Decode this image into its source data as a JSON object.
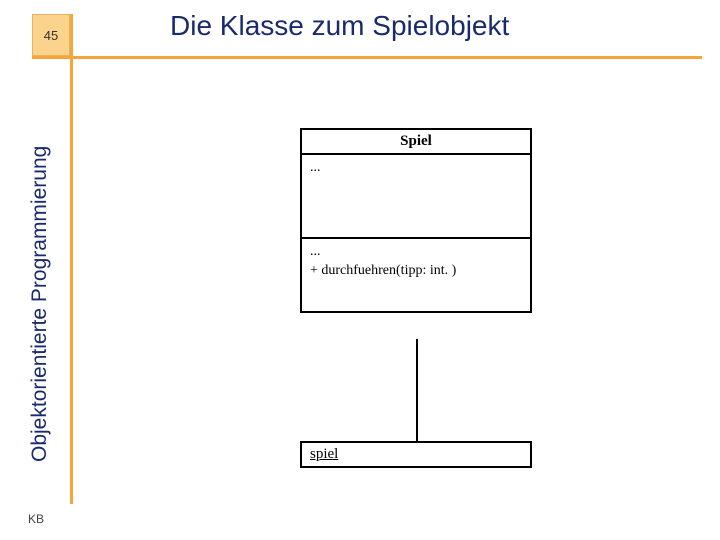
{
  "slide": {
    "number": "45",
    "title": "Die Klasse zum Spielobjekt",
    "side_label": "Objektorientierte Programmierung",
    "footer": "KB"
  },
  "uml": {
    "class_name": "Spiel",
    "attributes": "...",
    "operations_line1": "...",
    "operations_line2": "+ durchfuehren(tipp: int. )",
    "object_name": "spiel"
  }
}
